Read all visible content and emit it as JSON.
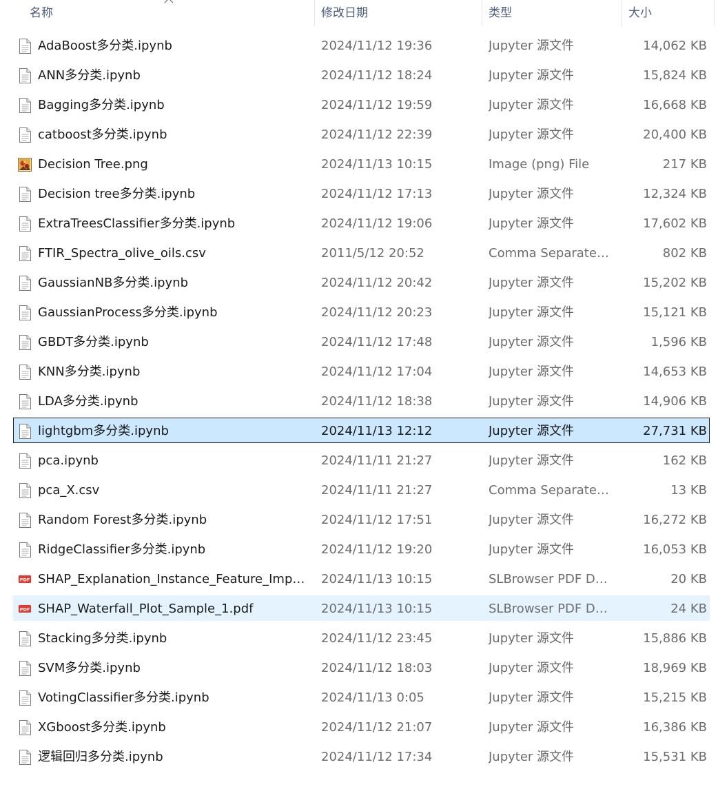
{
  "columns": {
    "name": "名称",
    "modified": "修改日期",
    "type": "类型",
    "size": "大小"
  },
  "sort": {
    "column": "name",
    "icon": "sort-up-chevron-icon"
  },
  "selected_index": 13,
  "hover_index": 19,
  "files": [
    {
      "name": "AdaBoost多分类.ipynb",
      "modified": "2024/11/12 19:36",
      "type": "Jupyter 源文件",
      "size": "14,062 KB",
      "icon": "document-icon"
    },
    {
      "name": "ANN多分类.ipynb",
      "modified": "2024/11/12 18:24",
      "type": "Jupyter 源文件",
      "size": "15,824 KB",
      "icon": "document-icon"
    },
    {
      "name": "Bagging多分类.ipynb",
      "modified": "2024/11/12 19:59",
      "type": "Jupyter 源文件",
      "size": "16,668 KB",
      "icon": "document-icon"
    },
    {
      "name": "catboost多分类.ipynb",
      "modified": "2024/11/12 22:39",
      "type": "Jupyter 源文件",
      "size": "20,400 KB",
      "icon": "document-icon"
    },
    {
      "name": "Decision Tree.png",
      "modified": "2024/11/13 10:15",
      "type": "Image (png) File",
      "size": "217 KB",
      "icon": "image-icon"
    },
    {
      "name": "Decision tree多分类.ipynb",
      "modified": "2024/11/12 17:13",
      "type": "Jupyter 源文件",
      "size": "12,324 KB",
      "icon": "document-icon"
    },
    {
      "name": "ExtraTreesClassifier多分类.ipynb",
      "modified": "2024/11/12 19:06",
      "type": "Jupyter 源文件",
      "size": "17,602 KB",
      "icon": "document-icon"
    },
    {
      "name": "FTIR_Spectra_olive_oils.csv",
      "modified": "2011/5/12 20:52",
      "type": "Comma Separated ...",
      "size": "802 KB",
      "icon": "document-icon"
    },
    {
      "name": "GaussianNB多分类.ipynb",
      "modified": "2024/11/12 20:42",
      "type": "Jupyter 源文件",
      "size": "15,202 KB",
      "icon": "document-icon"
    },
    {
      "name": "GaussianProcess多分类.ipynb",
      "modified": "2024/11/12 20:23",
      "type": "Jupyter 源文件",
      "size": "15,121 KB",
      "icon": "document-icon"
    },
    {
      "name": "GBDT多分类.ipynb",
      "modified": "2024/11/12 17:48",
      "type": "Jupyter 源文件",
      "size": "1,596 KB",
      "icon": "document-icon"
    },
    {
      "name": "KNN多分类.ipynb",
      "modified": "2024/11/12 17:04",
      "type": "Jupyter 源文件",
      "size": "14,653 KB",
      "icon": "document-icon"
    },
    {
      "name": "LDA多分类.ipynb",
      "modified": "2024/11/12 18:38",
      "type": "Jupyter 源文件",
      "size": "14,906 KB",
      "icon": "document-icon"
    },
    {
      "name": "lightgbm多分类.ipynb",
      "modified": "2024/11/13 12:12",
      "type": "Jupyter 源文件",
      "size": "27,731 KB",
      "icon": "document-icon"
    },
    {
      "name": "pca.ipynb",
      "modified": "2024/11/11 21:27",
      "type": "Jupyter 源文件",
      "size": "162 KB",
      "icon": "document-icon"
    },
    {
      "name": "pca_X.csv",
      "modified": "2024/11/11 21:27",
      "type": "Comma Separated ...",
      "size": "13 KB",
      "icon": "document-icon"
    },
    {
      "name": "Random Forest多分类.ipynb",
      "modified": "2024/11/12 17:51",
      "type": "Jupyter 源文件",
      "size": "16,272 KB",
      "icon": "document-icon"
    },
    {
      "name": "RidgeClassifier多分类.ipynb",
      "modified": "2024/11/12 19:20",
      "type": "Jupyter 源文件",
      "size": "16,053 KB",
      "icon": "document-icon"
    },
    {
      "name": "SHAP_Explanation_Instance_Feature_Import...",
      "modified": "2024/11/13 10:15",
      "type": "SLBrowser PDF Doc...",
      "size": "20 KB",
      "icon": "pdf-icon"
    },
    {
      "name": "SHAP_Waterfall_Plot_Sample_1.pdf",
      "modified": "2024/11/13 10:15",
      "type": "SLBrowser PDF Doc...",
      "size": "24 KB",
      "icon": "pdf-icon"
    },
    {
      "name": "Stacking多分类.ipynb",
      "modified": "2024/11/12 23:45",
      "type": "Jupyter 源文件",
      "size": "15,886 KB",
      "icon": "document-icon"
    },
    {
      "name": "SVM多分类.ipynb",
      "modified": "2024/11/12 18:03",
      "type": "Jupyter 源文件",
      "size": "18,969 KB",
      "icon": "document-icon"
    },
    {
      "name": "VotingClassifier多分类.ipynb",
      "modified": "2024/11/13 0:05",
      "type": "Jupyter 源文件",
      "size": "15,215 KB",
      "icon": "document-icon"
    },
    {
      "name": "XGboost多分类.ipynb",
      "modified": "2024/11/12 21:07",
      "type": "Jupyter 源文件",
      "size": "16,386 KB",
      "icon": "document-icon"
    },
    {
      "name": "逻辑回归多分类.ipynb",
      "modified": "2024/11/12 17:34",
      "type": "Jupyter 源文件",
      "size": "15,531 KB",
      "icon": "document-icon"
    }
  ]
}
